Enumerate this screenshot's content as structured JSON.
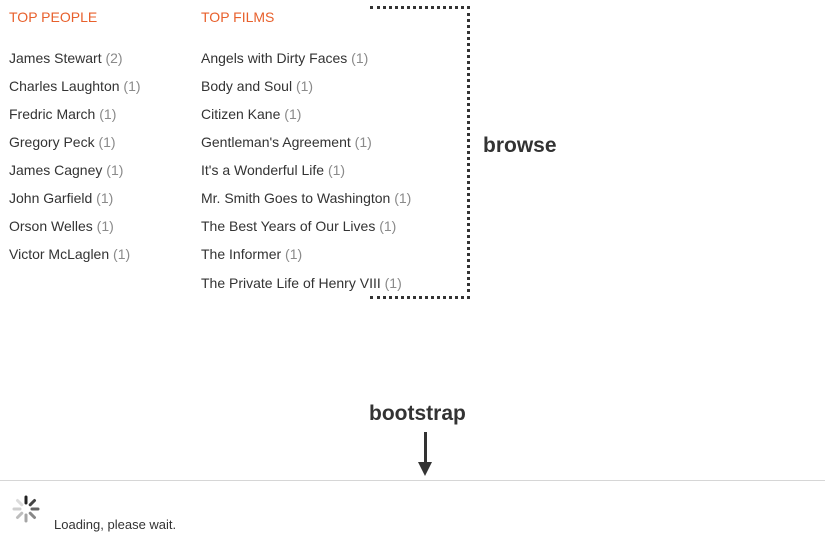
{
  "top_people": {
    "heading": "TOP PEOPLE",
    "items": [
      {
        "name": "James Stewart",
        "count": "(2)"
      },
      {
        "name": "Charles Laughton",
        "count": "(1)"
      },
      {
        "name": "Fredric March",
        "count": "(1)"
      },
      {
        "name": "Gregory Peck",
        "count": "(1)"
      },
      {
        "name": "James Cagney",
        "count": "(1)"
      },
      {
        "name": "John Garfield",
        "count": "(1)"
      },
      {
        "name": "Orson Welles",
        "count": "(1)"
      },
      {
        "name": "Victor McLaglen",
        "count": "(1)"
      }
    ]
  },
  "top_films": {
    "heading": "TOP FILMS",
    "items": [
      {
        "name": "Angels with Dirty Faces",
        "count": "(1)"
      },
      {
        "name": "Body and Soul",
        "count": "(1)"
      },
      {
        "name": "Citizen Kane",
        "count": "(1)"
      },
      {
        "name": "Gentleman's Agreement",
        "count": "(1)"
      },
      {
        "name": "It's a Wonderful Life",
        "count": "(1)"
      },
      {
        "name": "Mr. Smith Goes to Washington",
        "count": "(1)"
      },
      {
        "name": "The Best Years of Our Lives",
        "count": "(1)"
      },
      {
        "name": "The Informer",
        "count": "(1)"
      },
      {
        "name": "The Private Life of Henry VIII",
        "count": "(1)"
      }
    ]
  },
  "annotations": {
    "browse": "browse",
    "bootstrap": "bootstrap"
  },
  "loading": {
    "text": "Loading, please wait.",
    "icon": "spinner-icon"
  },
  "colors": {
    "heading": "#e8602c",
    "count": "#8a8a8a",
    "text": "#333333",
    "divider": "#d6d6d6"
  }
}
